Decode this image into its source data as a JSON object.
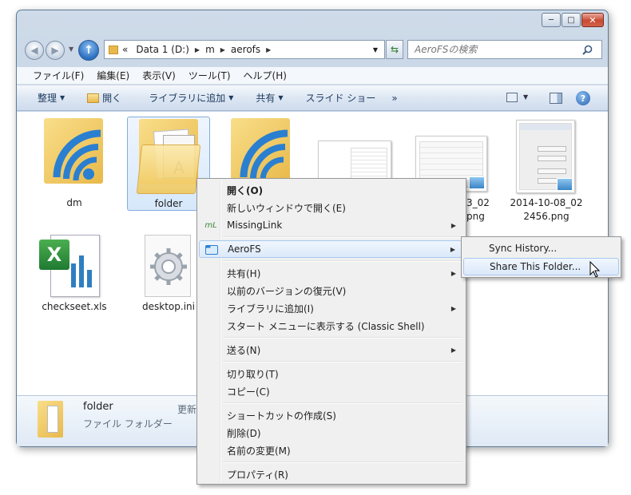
{
  "window": {
    "caption_buttons": {
      "minimize": "─",
      "maximize": "□",
      "close": "✕"
    }
  },
  "nav": {
    "back_glyph": "◀",
    "forward_glyph": "▶",
    "up_glyph": "↑",
    "breadcrumb_lead": "«",
    "breadcrumbs": [
      "Data 1 (D:)",
      "m",
      "aerofs"
    ],
    "search_placeholder": "AeroFSの検索"
  },
  "menubar": [
    "ファイル(F)",
    "編集(E)",
    "表示(V)",
    "ツール(T)",
    "ヘルプ(H)"
  ],
  "toolbar": {
    "organize": "整理",
    "open": "開く",
    "add_to_library": "ライブラリに追加",
    "share": "共有",
    "slideshow": "スライド ショー",
    "more": "»"
  },
  "files": [
    {
      "name": "dm",
      "type": "aerofs-folder"
    },
    {
      "name": "folder",
      "type": "folder",
      "selected": true
    },
    {
      "name": "",
      "type": "aerofs-folder"
    },
    {
      "name": "",
      "type": "image"
    },
    {
      "name": "3_02\npng",
      "type": "image"
    },
    {
      "name": "2014-10-08_02\n2456.png",
      "type": "image"
    },
    {
      "name": "checkseet.xls",
      "type": "excel"
    },
    {
      "name": "desktop.ini",
      "type": "ini"
    }
  ],
  "details": {
    "name": "folder",
    "type": "ファイル フォルダー",
    "modified_label": "更新"
  },
  "context_menu": {
    "items": [
      {
        "label": "開く(O)",
        "bold": true
      },
      {
        "label": "新しいウィンドウで開く(E)"
      },
      {
        "label": "MissingLink",
        "submenu": true,
        "icon": "mL"
      },
      {
        "sep": true
      },
      {
        "label": "AeroFS",
        "submenu": true,
        "highlight": true,
        "icon": "aerofs-icon"
      },
      {
        "sep": true
      },
      {
        "label": "共有(H)",
        "submenu": true
      },
      {
        "label": "以前のバージョンの復元(V)"
      },
      {
        "label": "ライブラリに追加(I)",
        "submenu": true
      },
      {
        "label": "スタート メニューに表示する (Classic Shell)"
      },
      {
        "sep": true
      },
      {
        "label": "送る(N)",
        "submenu": true
      },
      {
        "sep": true
      },
      {
        "label": "切り取り(T)"
      },
      {
        "label": "コピー(C)"
      },
      {
        "sep": true
      },
      {
        "label": "ショートカットの作成(S)"
      },
      {
        "label": "削除(D)"
      },
      {
        "label": "名前の変更(M)"
      },
      {
        "sep": true
      },
      {
        "label": "プロパティ(R)"
      }
    ]
  },
  "submenu": {
    "items": [
      {
        "label": "Sync History..."
      },
      {
        "label": "Share This Folder...",
        "highlight": true
      }
    ]
  },
  "colors": {
    "accent": "#2b6fc0",
    "aerofs_blue": "#2a7fd0",
    "folder_yellow": "#f0c85c",
    "excel_green": "#2a8a3a"
  }
}
